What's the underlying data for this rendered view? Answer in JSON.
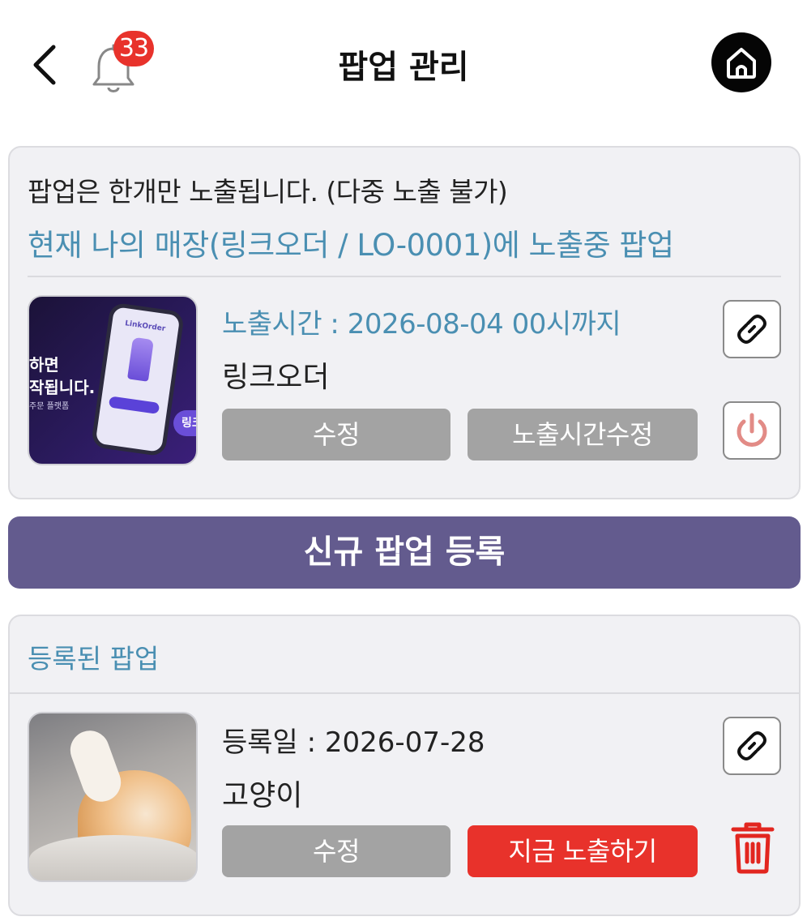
{
  "header": {
    "title": "팝업 관리",
    "notification_count": "33",
    "back_icon": "chevron-left-icon",
    "bell_icon": "bell-icon",
    "home_icon": "home-icon"
  },
  "current_popup_section": {
    "notice": "팝업은 한개만 노출됩니다. (다중 노출 불가)",
    "store_line": "현재 나의 매장(링크오더 / LO-0001)에 노출중 팝업",
    "popup": {
      "display_time": "노출시간 : 2026-08-04 00시까지",
      "name": "링크오더",
      "edit_label": "수정",
      "time_edit_label": "노출시간수정",
      "thumb_text_line1": "하면",
      "thumb_text_line2": "작됩니다.",
      "thumb_text_line3": "주문 플랫폼",
      "thumb_phone_brand": "LinkOrder",
      "thumb_pill": "링크"
    }
  },
  "new_popup_button": "신규 팝업 등록",
  "registered_section": {
    "title": "등록된 팝업",
    "items": [
      {
        "registered_date": "등록일 : 2026-07-28",
        "name": "고양이",
        "edit_label": "수정",
        "show_now_label": "지금 노출하기"
      }
    ]
  },
  "colors": {
    "accent_blue": "#4a8fb2",
    "primary_purple": "#635b8e",
    "danger_red": "#e8322b",
    "button_grey": "#a3a3a3",
    "power_icon": "#e28b86"
  }
}
